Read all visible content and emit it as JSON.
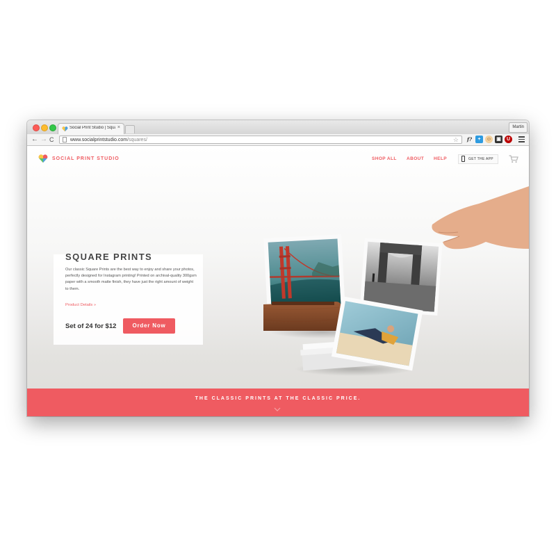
{
  "browser": {
    "tab_title": "Social Print Studio | Square",
    "tab_close": "×",
    "profile_name": "Martin",
    "url_host": "www.socialprintstudio.com",
    "url_path": "/squares/",
    "back_glyph": "←",
    "forward_glyph": "→",
    "reload_glyph": "C",
    "star_glyph": "☆",
    "extensions": [
      {
        "icon": "formula-f-icon",
        "glyph": "f?"
      },
      {
        "icon": "plus-extension-icon",
        "glyph": "+"
      },
      {
        "icon": "face-extension-icon",
        "glyph": "☺"
      },
      {
        "icon": "frame-extension-icon",
        "glyph": "▣"
      },
      {
        "icon": "ublock-icon",
        "glyph": "U"
      }
    ]
  },
  "site": {
    "logo_text": "SOCIAL PRINT STUDIO",
    "nav": {
      "shop_all": "SHOP ALL",
      "about": "ABOUT",
      "help": "HELP",
      "get_app": "GET THE APP"
    },
    "accent_color": "#ef5b61"
  },
  "hero": {
    "title": "SQUARE PRINTS",
    "description": "Our classic Square Prints are the best way to enjoy and share your photos, perfectly designed for Instagram printing! Printed on archival-quality 300gsm paper with a smooth matte finish, they have just the right amount of weight to them.",
    "details_link": "Product Details »",
    "price": "Set of 24 for $12",
    "order_button": "Order Now",
    "carousel": {
      "total": 4,
      "active": 1
    }
  },
  "banner": {
    "text": "THE CLASSIC PRINTS AT THE CLASSIC PRICE."
  }
}
